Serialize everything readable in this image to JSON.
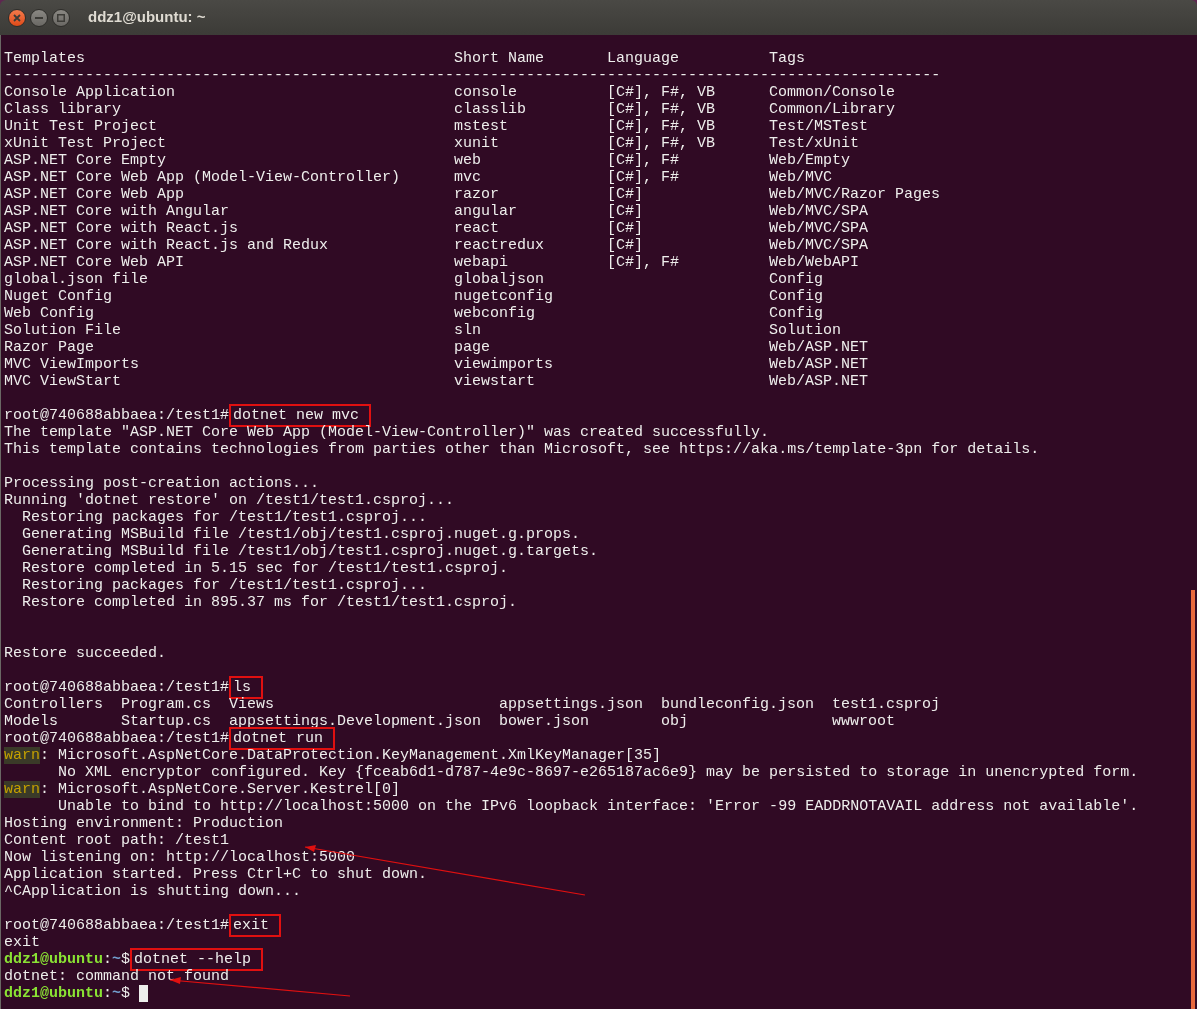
{
  "window": {
    "title": "ddz1@ubuntu: ~"
  },
  "templates_table": {
    "columns": [
      "Templates",
      "Short Name",
      "Language",
      "Tags"
    ],
    "separator": "--------------------------------------------------------------------------------------------------------",
    "rows": [
      [
        "Console Application",
        "console",
        "[C#], F#, VB",
        "Common/Console"
      ],
      [
        "Class library",
        "classlib",
        "[C#], F#, VB",
        "Common/Library"
      ],
      [
        "Unit Test Project",
        "mstest",
        "[C#], F#, VB",
        "Test/MSTest"
      ],
      [
        "xUnit Test Project",
        "xunit",
        "[C#], F#, VB",
        "Test/xUnit"
      ],
      [
        "ASP.NET Core Empty",
        "web",
        "[C#], F#",
        "Web/Empty"
      ],
      [
        "ASP.NET Core Web App (Model-View-Controller)",
        "mvc",
        "[C#], F#",
        "Web/MVC"
      ],
      [
        "ASP.NET Core Web App",
        "razor",
        "[C#]",
        "Web/MVC/Razor Pages"
      ],
      [
        "ASP.NET Core with Angular",
        "angular",
        "[C#]",
        "Web/MVC/SPA"
      ],
      [
        "ASP.NET Core with React.js",
        "react",
        "[C#]",
        "Web/MVC/SPA"
      ],
      [
        "ASP.NET Core with React.js and Redux",
        "reactredux",
        "[C#]",
        "Web/MVC/SPA"
      ],
      [
        "ASP.NET Core Web API",
        "webapi",
        "[C#], F#",
        "Web/WebAPI"
      ],
      [
        "global.json file",
        "globaljson",
        "",
        "Config"
      ],
      [
        "Nuget Config",
        "nugetconfig",
        "",
        "Config"
      ],
      [
        "Web Config",
        "webconfig",
        "",
        "Config"
      ],
      [
        "Solution File",
        "sln",
        "",
        "Solution"
      ],
      [
        "Razor Page",
        "page",
        "",
        "Web/ASP.NET"
      ],
      [
        "MVC ViewImports",
        "viewimports",
        "",
        "Web/ASP.NET"
      ],
      [
        "MVC ViewStart",
        "viewstart",
        "",
        "Web/ASP.NET"
      ]
    ]
  },
  "output": [
    {
      "kind": "blank"
    },
    {
      "kind": "prompt",
      "prompt": "root@740688abbaea:/test1#",
      "command": "dotnet new mvc",
      "highlighted": true
    },
    {
      "kind": "text",
      "text": "The template \"ASP.NET Core Web App (Model-View-Controller)\" was created successfully."
    },
    {
      "kind": "text",
      "text": "This template contains technologies from parties other than Microsoft, see https://aka.ms/template-3pn for details."
    },
    {
      "kind": "blank"
    },
    {
      "kind": "text",
      "text": "Processing post-creation actions..."
    },
    {
      "kind": "text",
      "text": "Running 'dotnet restore' on /test1/test1.csproj..."
    },
    {
      "kind": "text",
      "text": "  Restoring packages for /test1/test1.csproj..."
    },
    {
      "kind": "text",
      "text": "  Generating MSBuild file /test1/obj/test1.csproj.nuget.g.props."
    },
    {
      "kind": "text",
      "text": "  Generating MSBuild file /test1/obj/test1.csproj.nuget.g.targets."
    },
    {
      "kind": "text",
      "text": "  Restore completed in 5.15 sec for /test1/test1.csproj."
    },
    {
      "kind": "text",
      "text": "  Restoring packages for /test1/test1.csproj..."
    },
    {
      "kind": "text",
      "text": "  Restore completed in 895.37 ms for /test1/test1.csproj."
    },
    {
      "kind": "blank"
    },
    {
      "kind": "blank"
    },
    {
      "kind": "text",
      "text": "Restore succeeded."
    },
    {
      "kind": "blank"
    },
    {
      "kind": "prompt",
      "prompt": "root@740688abbaea:/test1#",
      "command": "ls",
      "highlighted": true
    },
    {
      "kind": "files",
      "entries": [
        "Controllers",
        "Program.cs",
        "Views",
        "appsettings.json",
        "bundleconfig.json",
        "test1.csproj"
      ]
    },
    {
      "kind": "files",
      "entries": [
        "Models",
        "Startup.cs",
        "appsettings.Development.json",
        "bower.json",
        "obj",
        "wwwroot"
      ]
    },
    {
      "kind": "prompt",
      "prompt": "root@740688abbaea:/test1#",
      "command": "dotnet run",
      "highlighted": true
    },
    {
      "kind": "warn",
      "label": "warn",
      "text": ": Microsoft.AspNetCore.DataProtection.KeyManagement.XmlKeyManager[35]"
    },
    {
      "kind": "text",
      "text": "      No XML encryptor configured. Key {fceab6d1-d787-4e9c-8697-e265187ac6e9} may be persisted to storage in unencrypted form."
    },
    {
      "kind": "warn",
      "label": "warn",
      "text": ": Microsoft.AspNetCore.Server.Kestrel[0]"
    },
    {
      "kind": "text",
      "text": "      Unable to bind to http://localhost:5000 on the IPv6 loopback interface: 'Error -99 EADDRNOTAVAIL address not available'."
    },
    {
      "kind": "text",
      "text": "Hosting environment: Production"
    },
    {
      "kind": "text",
      "text": "Content root path: /test1"
    },
    {
      "kind": "text",
      "text": "Now listening on: http://localhost:5000"
    },
    {
      "kind": "text",
      "text": "Application started. Press Ctrl+C to shut down."
    },
    {
      "kind": "text",
      "text": "^CApplication is shutting down..."
    },
    {
      "kind": "blank"
    },
    {
      "kind": "prompt",
      "prompt": "root@740688abbaea:/test1#",
      "command": "exit",
      "highlighted": true
    },
    {
      "kind": "text",
      "text": "exit"
    },
    {
      "kind": "user_prompt",
      "user": "ddz1@ubuntu",
      "separator": ":",
      "path": "~",
      "symbol": "$",
      "command": "dotnet --help",
      "highlighted": true
    },
    {
      "kind": "text",
      "text": "dotnet: command not found"
    },
    {
      "kind": "user_prompt",
      "user": "ddz1@ubuntu",
      "separator": ":",
      "path": "~",
      "symbol": "$",
      "cursor": true
    }
  ]
}
